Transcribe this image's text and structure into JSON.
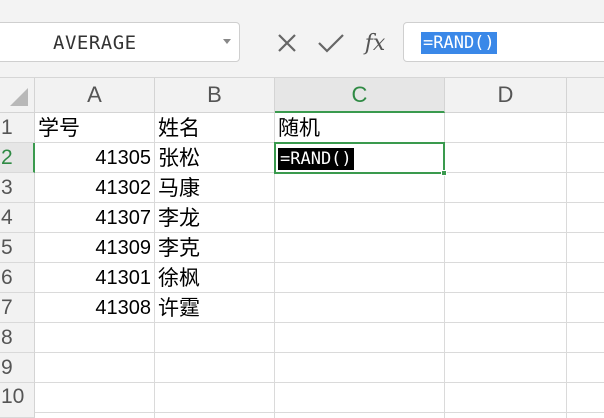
{
  "formula_bar": {
    "name_box": "AVERAGE",
    "cancel_icon": "close-icon",
    "confirm_icon": "check-icon",
    "fx_label": "fx",
    "formula": "=RAND()"
  },
  "columns": [
    "A",
    "B",
    "C",
    "D"
  ],
  "rows": [
    "1",
    "2",
    "3",
    "4",
    "5",
    "6",
    "7",
    "8",
    "9",
    "10"
  ],
  "active": {
    "column": "C",
    "row": "2",
    "edit_text": "=RAND()"
  },
  "cells": {
    "A1": "学号",
    "B1": "姓名",
    "C1": "随机",
    "A2": "41305",
    "B2": "张松",
    "A3": "41302",
    "B3": "马康",
    "A4": "41307",
    "B4": "李龙",
    "A5": "41309",
    "B5": "李克",
    "A6": "41301",
    "B6": "徐枫",
    "A7": "41308",
    "B7": "许霆"
  },
  "colors": {
    "accent": "#3a9a4e",
    "selection": "#3a88e8"
  }
}
